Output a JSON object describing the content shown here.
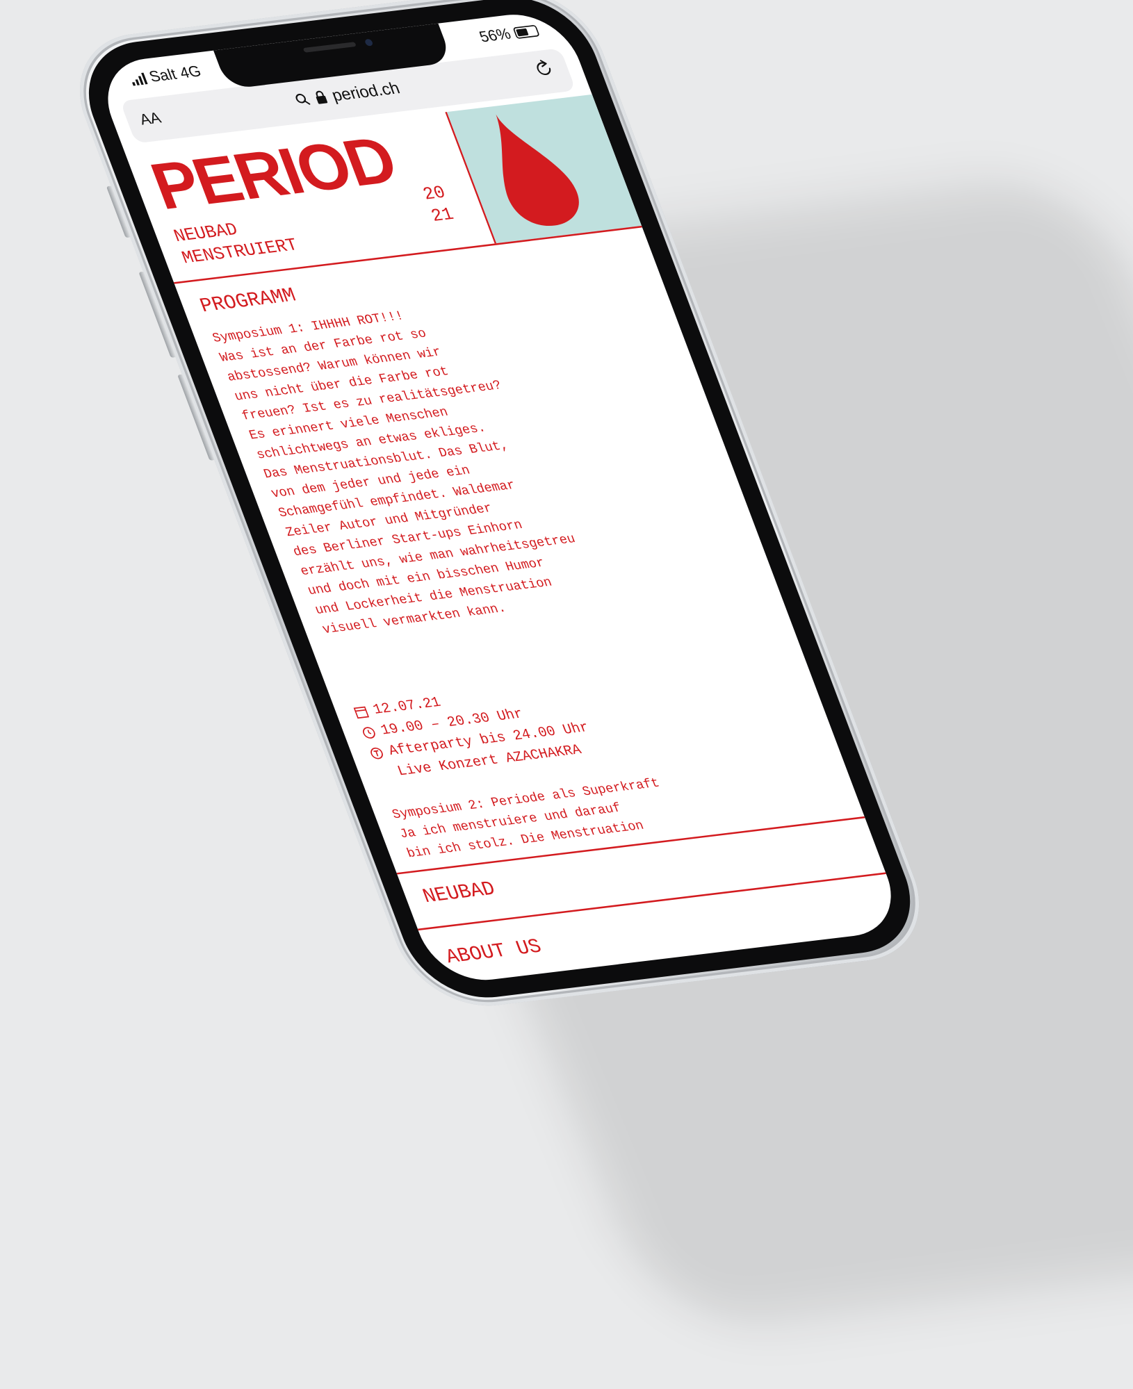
{
  "status_bar": {
    "carrier": "Salt",
    "network": "4G",
    "battery": "56%",
    "battery_level": 0.56
  },
  "browser": {
    "text_size_label": "AA",
    "url": "period.ch",
    "search_icon": "search-icon",
    "lock_icon": "lock-icon",
    "reload_icon": "reload-icon"
  },
  "hero": {
    "logo": "PERIOD",
    "subtitle_line1": "NEUBAD",
    "subtitle_line2": "MENSTRUIERT",
    "year_line1": "20",
    "year_line2": "21",
    "accent_color": "#d31b1f",
    "panel_color": "#bfe0de",
    "drop_icon": "blood-drop-icon"
  },
  "programm": {
    "title": "PROGRAMM",
    "symposium1_text": "Symposium 1: IHHHH ROT!!!\nWas ist an der Farbe rot so\nabstossend? Warum können wir\nuns nicht über die Farbe rot\nfreuen? Ist es zu realitätsgetreu?\nEs erinnert viele Menschen\nschlichtwegs an etwas ekliges.\nDas Menstruationsblut. Das Blut,\nvon dem jeder und jede ein\nSchamgefühl empfindet. Waldemar\nZeiler Autor und Mitgründer\ndes Berliner Start-ups Einhorn\nerzählt uns, wie man wahrheitsgetreu\nund doch mit ein bisschen Humor\nund Lockerheit die Menstruation\nvisuell vermarkten kann.",
    "date": "12.07.21",
    "time": "19.00 – 20.30 Uhr",
    "afterparty": "Afterparty bis 24.00 Uhr",
    "concert": "Live Konzert AZACHAKRA",
    "symposium2_text": "Symposium 2: Periode als Superkraft\nJa ich menstruiere und darauf\nbin ich stolz. Die Menstruation"
  },
  "nav": {
    "items": [
      "NEUBAD",
      "ABOUT US"
    ]
  }
}
